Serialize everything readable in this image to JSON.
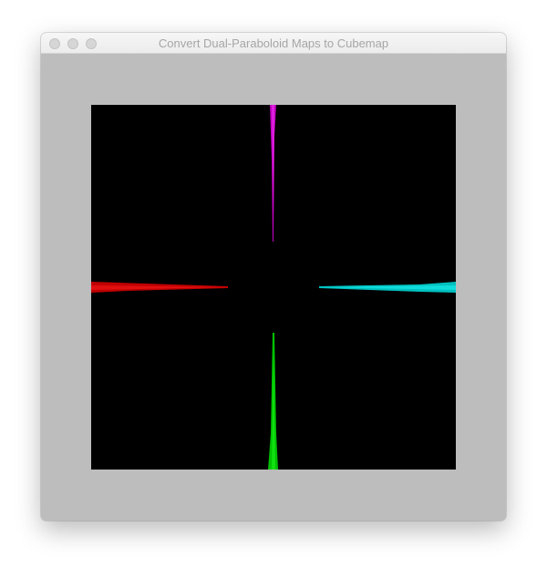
{
  "window": {
    "title": "Convert Dual-Paraboloid Maps to Cubemap"
  },
  "viewport": {
    "background": "#000000",
    "frame_color": "#bdbdbd",
    "axis_colors": {
      "top": "#c000c0",
      "left": "#c00000",
      "right": "#00c0c0",
      "bottom": "#00c000"
    }
  }
}
